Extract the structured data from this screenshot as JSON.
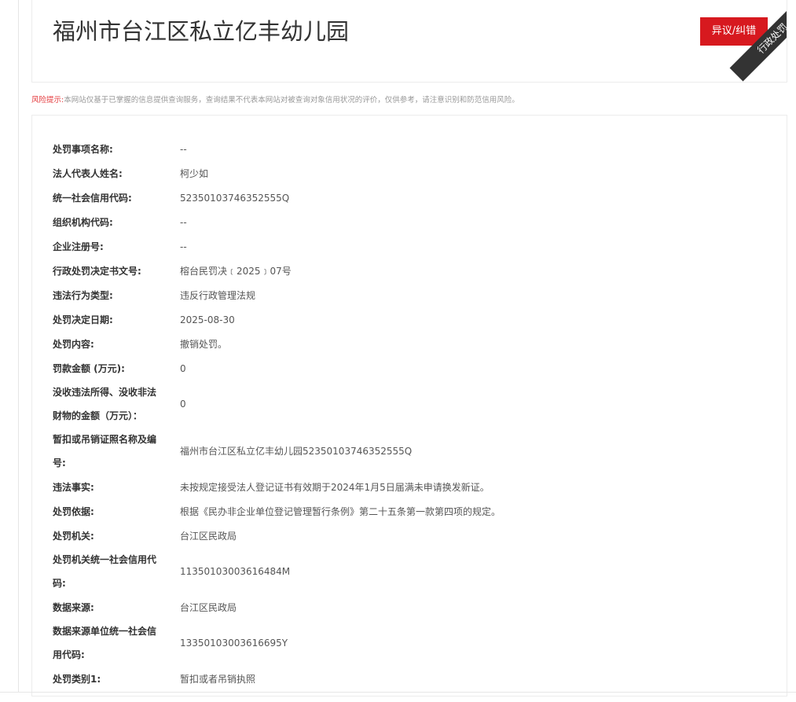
{
  "header": {
    "title": "福州市台江区私立亿丰幼儿园",
    "dispute_button_label": "异议/纠错",
    "ribbon_label": "行政处罚"
  },
  "risk_notice": {
    "label": "风险提示:",
    "text": "本网站仅基于已掌握的信息提供查询服务，查询结果不代表本网站对被查询对象信用状况的评价，仅供参考，请注意识别和防范信用风险。"
  },
  "details": [
    {
      "label": "处罚事项名称:",
      "value": "--"
    },
    {
      "label": "法人代表人姓名:",
      "value": "柯少如"
    },
    {
      "label": "统一社会信用代码:",
      "value": "52350103746352555Q"
    },
    {
      "label": "组织机构代码:",
      "value": "--"
    },
    {
      "label": "企业注册号:",
      "value": "--"
    },
    {
      "label": "行政处罚决定书文号:",
      "value": "榕台民罚决﹝2025﹞07号"
    },
    {
      "label": "违法行为类型:",
      "value": "违反行政管理法规"
    },
    {
      "label": "处罚决定日期:",
      "value": "2025-08-30"
    },
    {
      "label": "处罚内容:",
      "value": "撤销处罚。"
    },
    {
      "label": "罚款金额 (万元):",
      "value": "0"
    },
    {
      "label": "没收违法所得、没收非法财物的金额（万元）：",
      "value": "0"
    },
    {
      "label": "暂扣或吊销证照名称及编号:",
      "value": "福州市台江区私立亿丰幼儿园52350103746352555Q"
    },
    {
      "label": "违法事实:",
      "value": "未按规定接受法人登记证书有效期于2024年1月5日届满未申请换发新证。"
    },
    {
      "label": "处罚依据:",
      "value": "根据《民办非企业单位登记管理暂行条例》第二十五条第一款第四项的规定。"
    },
    {
      "label": "处罚机关:",
      "value": "台江区民政局"
    },
    {
      "label": "处罚机关统一社会信用代码:",
      "value": "11350103003616484M"
    },
    {
      "label": "数据来源:",
      "value": "台江区民政局"
    },
    {
      "label": "数据来源单位统一社会信用代码:",
      "value": "13350103003616695Y"
    },
    {
      "label": "处罚类别1:",
      "value": "暂扣或者吊销执照"
    }
  ]
}
